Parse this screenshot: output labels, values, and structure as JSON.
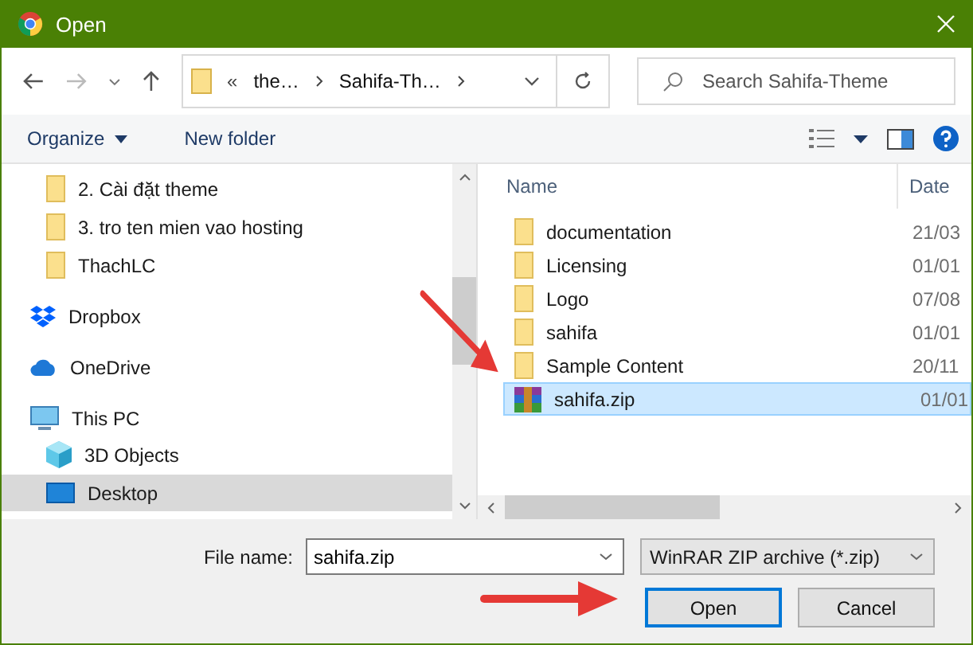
{
  "window": {
    "title": "Open"
  },
  "address": {
    "overflow": "«",
    "segments": [
      "the…",
      "Sahifa-Th…"
    ]
  },
  "search": {
    "placeholder": "Search Sahifa-Theme"
  },
  "commands": {
    "organize": "Organize",
    "new_folder": "New folder"
  },
  "sidebar": {
    "items": [
      {
        "label": "2. Cài đặt theme",
        "kind": "folder",
        "selected": false
      },
      {
        "label": "3. tro ten mien vao hosting",
        "kind": "folder",
        "selected": false
      },
      {
        "label": "ThachLC",
        "kind": "folder",
        "selected": false
      },
      {
        "label": "Dropbox",
        "kind": "dropbox",
        "selected": false
      },
      {
        "label": "OneDrive",
        "kind": "onedrive",
        "selected": false
      },
      {
        "label": "This PC",
        "kind": "pc",
        "selected": false,
        "children": [
          {
            "label": "3D Objects",
            "kind": "objects",
            "selected": false
          },
          {
            "label": "Desktop",
            "kind": "desktop",
            "selected": true
          }
        ]
      }
    ]
  },
  "files": {
    "columns": [
      "Name",
      "Date"
    ],
    "rows": [
      {
        "name": "documentation",
        "date": "21/03",
        "kind": "folder",
        "selected": false
      },
      {
        "name": "Licensing",
        "date": "01/01",
        "kind": "folder",
        "selected": false
      },
      {
        "name": "Logo",
        "date": "07/08",
        "kind": "folder",
        "selected": false
      },
      {
        "name": "sahifa",
        "date": "01/01",
        "kind": "folder",
        "selected": false
      },
      {
        "name": "Sample Content",
        "date": "20/11",
        "kind": "folder",
        "selected": false
      },
      {
        "name": "sahifa.zip",
        "date": "01/01",
        "kind": "zip",
        "selected": true
      }
    ]
  },
  "file_name": {
    "label": "File name:",
    "value": "sahifa.zip"
  },
  "filter": {
    "value": "WinRAR ZIP archive (*.zip)"
  },
  "buttons": [
    {
      "label": "Open",
      "default": true
    },
    {
      "label": "Cancel",
      "default": false
    }
  ]
}
